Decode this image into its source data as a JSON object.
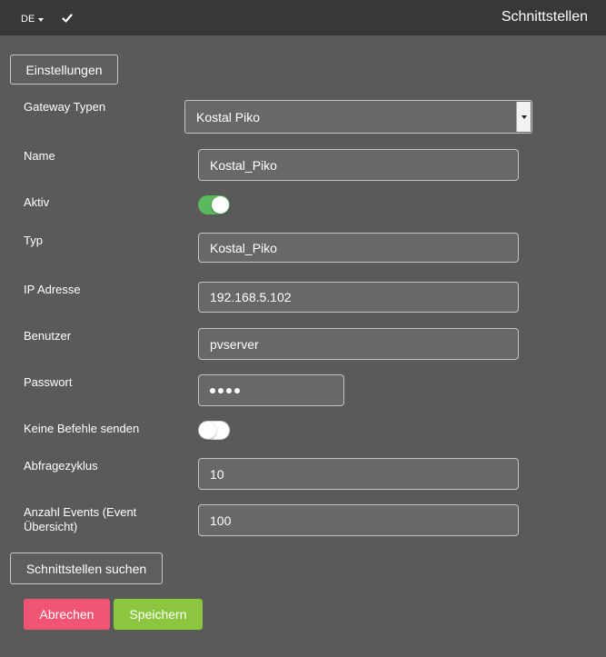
{
  "header": {
    "language": "DE",
    "title": "Schnittstellen"
  },
  "buttons": {
    "settings": "Einstellungen",
    "search_interfaces": "Schnittstellen suchen",
    "cancel": "Abrechen",
    "save": "Speichern"
  },
  "form": {
    "gateway_type": {
      "label": "Gateway Typen",
      "value": "Kostal Piko"
    },
    "name": {
      "label": "Name",
      "value": "Kostal_Piko"
    },
    "active": {
      "label": "Aktiv",
      "on": true
    },
    "type": {
      "label": "Typ",
      "value": "Kostal_Piko"
    },
    "ip_address": {
      "label": "IP Adresse",
      "value": "192.168.5.102"
    },
    "user": {
      "label": "Benutzer",
      "value": "pvserver"
    },
    "password": {
      "label": "Passwort",
      "masked_length": 4
    },
    "no_commands": {
      "label": "Keine Befehle senden",
      "on": false
    },
    "poll_cycle": {
      "label": "Abfragezyklus",
      "value": "10"
    },
    "event_count": {
      "label": "Anzahl Events (Event Übersicht)",
      "value": "100"
    }
  },
  "colors": {
    "background": "#5a5a5a",
    "topbar": "#383838",
    "cancel": "#f25573",
    "save": "#8cc63f",
    "toggle_on": "#5cb85c"
  }
}
